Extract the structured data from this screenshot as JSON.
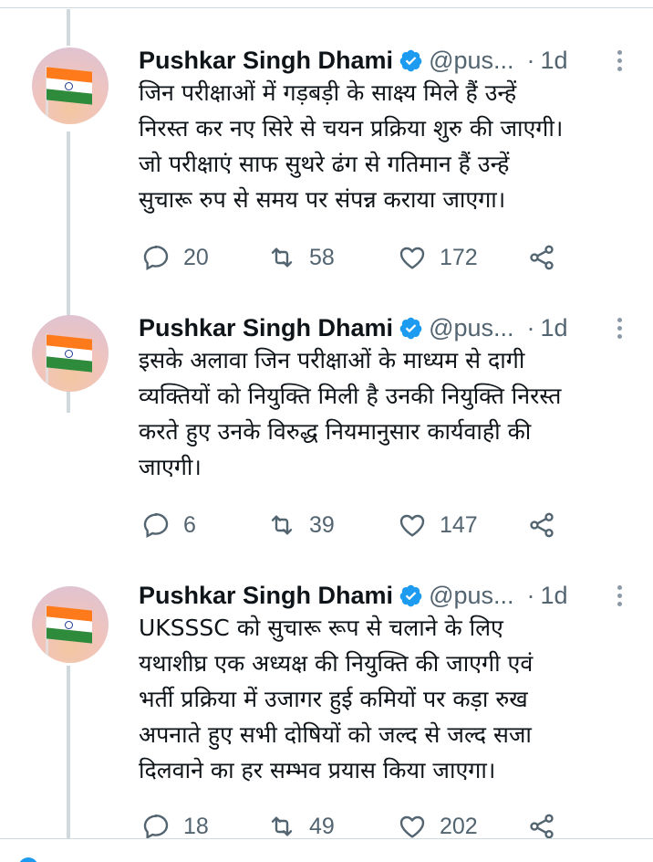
{
  "colors": {
    "verified": "#1d9bf0",
    "icon_gray": "#536471",
    "text": "#0f1419",
    "thread_line": "#cfd9de"
  },
  "tweets": [
    {
      "author": {
        "name": "Pushkar Singh Dhami",
        "handle": "@pus...",
        "separator": "·",
        "time": "1d",
        "avatar_icon": "india-flag-avatar",
        "badge_icon": "verified-badge-icon"
      },
      "text": "जिन परीक्षाओं में गड़बड़ी के साक्ष्य मिले हैं उन्हें\nनिरस्त कर नए सिरे से चयन प्रक्रिया शुरु की जाएगी।\nजो परीक्षाएं साफ सुथरे ढंग से गतिमान हैं उन्हें\nसुचारू रुप से समय पर संपन्न कराया जाएगा।",
      "replies": "20",
      "retweets": "58",
      "likes": "172"
    },
    {
      "author": {
        "name": "Pushkar Singh Dhami",
        "handle": "@pus...",
        "separator": "·",
        "time": "1d",
        "avatar_icon": "india-flag-avatar",
        "badge_icon": "verified-badge-icon"
      },
      "text": "इसके अलावा जिन परीक्षाओं के माध्यम से दागी\nव्यक्तियों को नियुक्ति मिली है उनकी नियुक्ति निरस्त\nकरते हुए उनके विरुद्ध नियमानुसार कार्यवाही की\nजाएगी।",
      "replies": "6",
      "retweets": "39",
      "likes": "147"
    },
    {
      "author": {
        "name": "Pushkar Singh Dhami",
        "handle": "@pus...",
        "separator": "·",
        "time": "1d",
        "avatar_icon": "india-flag-avatar",
        "badge_icon": "verified-badge-icon"
      },
      "text": "UKSSSC को सुचारू रूप से चलाने के लिए\nयथाशीघ्र एक अध्यक्ष की नियुक्ति की जाएगी एवं\nभर्ती प्रक्रिया में उजागर हुई कमियों पर कड़ा रुख\nअपनाते हुए सभी दोषियों को जल्द से जल्द सजा\nदिलवाने का हर सम्भव प्रयास किया जाएगा।",
      "replies": "18",
      "retweets": "49",
      "likes": "202"
    }
  ],
  "icons": {
    "reply": "reply-icon",
    "retweet": "retweet-icon",
    "like": "like-icon",
    "share": "share-icon",
    "more": "more-options-icon"
  }
}
